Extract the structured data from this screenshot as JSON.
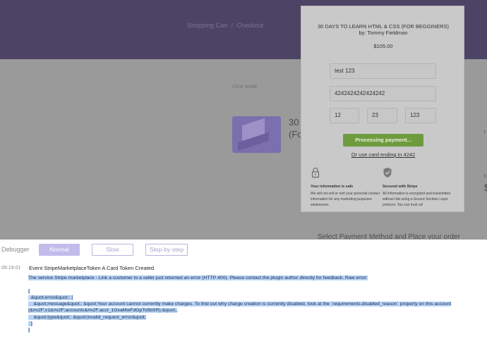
{
  "page": {
    "breadcrumb": [
      "Shopping Cart",
      "/",
      "Checkout"
    ],
    "column_header": "ITEM NAME",
    "item_title_lines": [
      "30",
      "(Fo"
    ],
    "right_number": "$",
    "right_fragments": [
      "T",
      "S"
    ],
    "select_method": "Select Payment Method and Place your order"
  },
  "modal": {
    "title": "30 DAYS TO LEARN HTML & CSS (FOR BEGGINERS)",
    "author": "by: Tommy Fieldman",
    "price": "$105.00",
    "name_value": "test  123",
    "card_value": "4242424242424242",
    "month_value": "12",
    "year_value": "23",
    "cvc_value": "123",
    "pay_label": "Processing payment...",
    "saved_card_link": "Or use card ending in 4242",
    "features": [
      {
        "icon": "lock-icon",
        "heading": "Your information is safe",
        "body": "We will not sell or rent your personal contact information for any marketing purposes whatsoever."
      },
      {
        "icon": "shield-check-icon",
        "heading": "Secured with Stripe",
        "body": "All information is encrypted and transmitted without risk using a Secure Sockets Layer protocol. You can trust us!"
      }
    ],
    "pay_button_color": "#6f9b3f"
  },
  "debugger": {
    "label": "Debugger",
    "modes": [
      "Normal",
      "Slow",
      "Step-by-step"
    ],
    "active_mode": "Normal",
    "accent_color": "#c1bcec",
    "log": {
      "time": "08:19:01",
      "event": "Event StripeMarketplaceToken A Card Token Created",
      "lines": [
        "The service Stripe marketplace - Link a customer to a seller just returned an error (HTTP 400). Please contact the plugin author directly for feedback. Raw error:",
        "",
        "{",
        "  &quot;error&quot;: {",
        "    &quot;message&quot;: &quot;Your account cannot currently make charges. To find out why charge creation is currently disabled, look at the `requirements.disabled_reason` property on this account",
        "(&#x2F;v1&#x2F;accounts&#x2F;acct_1GxaMwFdGpTo5bSR).&quot;,",
        "    &quot;type&quot;: &quot;invalid_request_error&quot;",
        "  }",
        "}"
      ]
    }
  }
}
